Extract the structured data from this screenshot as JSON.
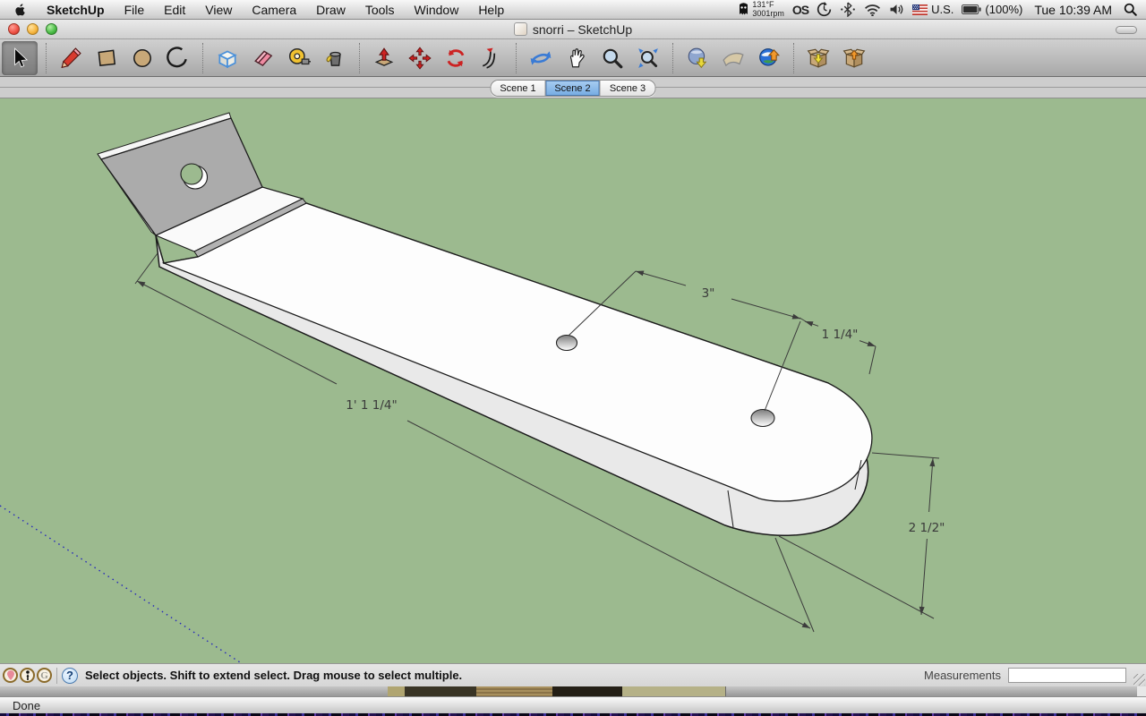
{
  "menubar": {
    "items": [
      "SketchUp",
      "File",
      "Edit",
      "View",
      "Camera",
      "Draw",
      "Tools",
      "Window",
      "Help"
    ],
    "status": {
      "temperature": "131°F",
      "fan_speed": "3001rpm",
      "lastfm_logo": "OS",
      "input_source": "U.S.",
      "battery": "(100%)",
      "clock": "Tue 10:39 AM"
    }
  },
  "window": {
    "title": "snorri – SketchUp"
  },
  "toolbar": {
    "active_tool": "select",
    "tools": [
      "select",
      "line",
      "rectangle",
      "circle",
      "arc",
      "make-component",
      "eraser",
      "tape-measure",
      "paint-bucket",
      "push-pull",
      "move",
      "rotate",
      "follow-me",
      "orbit",
      "pan",
      "zoom",
      "zoom-extents",
      "get-current-view",
      "toggle-terrain",
      "place-model",
      "get-models",
      "share-model"
    ]
  },
  "scene_tabs": [
    {
      "label": "Scene 1"
    },
    {
      "label": "Scene 2"
    },
    {
      "label": "Scene 3"
    }
  ],
  "canvas": {
    "background_color": "#9cba8f",
    "model_description": "White bracket with bent gray plate, rounded end, three holes",
    "dimensions": {
      "hole_spacing": "3\"",
      "hole_to_end": "1 1/4\"",
      "length": "1' 1 1/4\"",
      "width": "2 1/2\""
    }
  },
  "statusbar": {
    "hint": "Select objects. Shift to extend select. Drag mouse to select multiple.",
    "measurements_label": "Measurements",
    "measurements_value": ""
  },
  "background_window": {
    "status": "Done"
  },
  "colors": {
    "selected_tab_blue": "#76aee3",
    "model_gray": "#acacac",
    "dimension_text": "#3a3a3a"
  }
}
